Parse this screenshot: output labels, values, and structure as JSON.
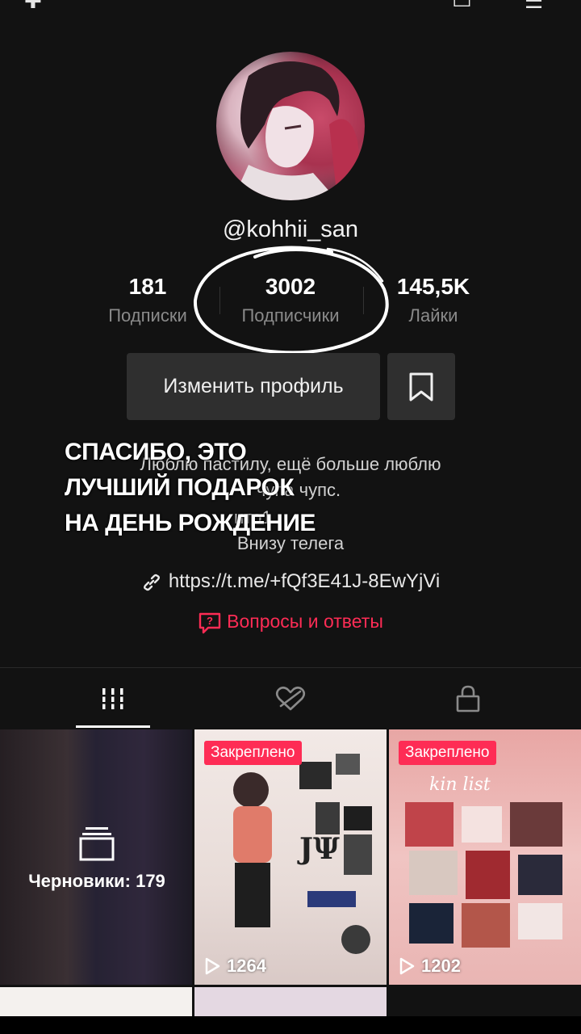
{
  "profile": {
    "username": "@kohhii_san",
    "stats": [
      {
        "value": "181",
        "label": "Подписки"
      },
      {
        "value": "3002",
        "label": "Подписчики"
      },
      {
        "value": "145,5K",
        "label": "Лайки"
      }
    ],
    "edit_profile_label": "Изменить профиль",
    "bio_lines": [
      "Люблю пастилу, ещё больше люблю",
      "чупа чупс.",
      "ито1",
      "Внизу телега"
    ],
    "link": "https://t.me/+fQf3E41J-8EwYjVi",
    "qa_label": "Вопросы и ответы"
  },
  "overlay_text": [
    "СПАСИБО, ЭТО",
    "ЛУЧШИЙ ПОДАРОК",
    "НА ДЕНЬ РОЖДЕНИЕ"
  ],
  "tabs": [
    {
      "icon": "grid-icon",
      "active": true
    },
    {
      "icon": "liked-hidden-icon",
      "active": false
    },
    {
      "icon": "lock-icon",
      "active": false
    }
  ],
  "videos": [
    {
      "drafts_label": "Черновики: 179"
    },
    {
      "badge": "Закреплено",
      "views": "1264"
    },
    {
      "badge": "Закреплено",
      "views": "1202"
    }
  ],
  "colors": {
    "accent": "#fe2c55",
    "background": "#121212",
    "button": "#2f2f2f"
  }
}
